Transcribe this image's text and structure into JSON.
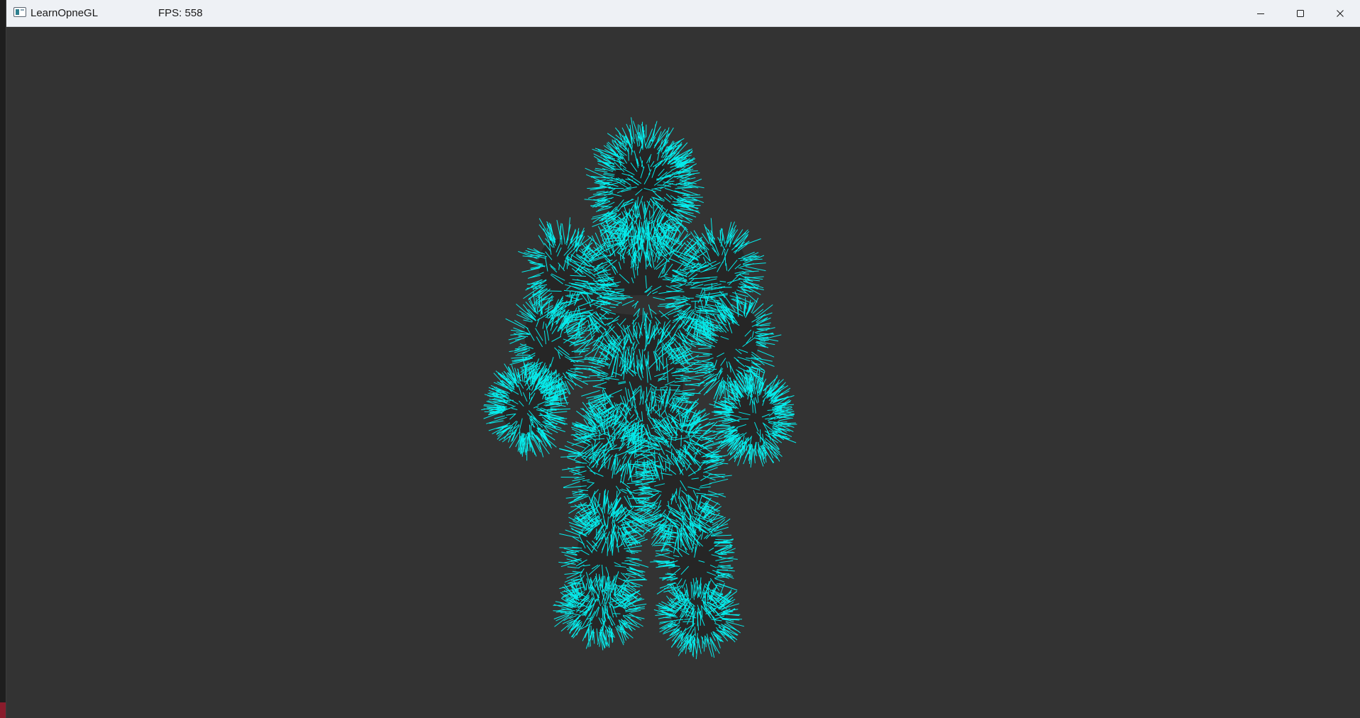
{
  "window": {
    "title": "LearnOpneGL",
    "fps_label": "FPS: 558",
    "icon": "app-window-icon",
    "controls": {
      "minimize_icon": "minimize-icon",
      "maximize_icon": "maximize-icon",
      "close_icon": "close-icon"
    }
  },
  "scene": {
    "background_color": "#333333",
    "model_body_color": "#262626",
    "normal_line_color": "#00ffff",
    "description_icon": "nanosuit-model-with-normals"
  }
}
